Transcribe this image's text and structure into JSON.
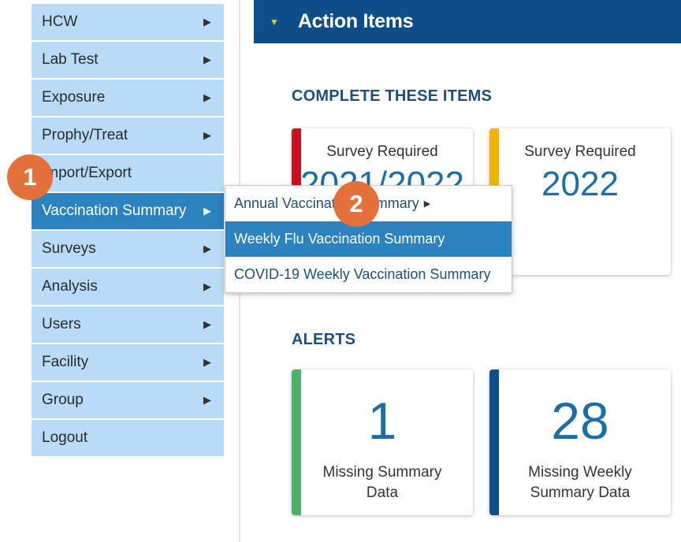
{
  "menu": {
    "items": [
      {
        "label": "HCW",
        "arrow": "▶"
      },
      {
        "label": "Lab Test",
        "arrow": "▶"
      },
      {
        "label": "Exposure",
        "arrow": "▶"
      },
      {
        "label": "Prophy/Treat",
        "arrow": "▶"
      },
      {
        "label": "Import/Export",
        "arrow": ""
      },
      {
        "label": "Vaccination Summary",
        "arrow": "▶"
      },
      {
        "label": "Surveys",
        "arrow": "▶"
      },
      {
        "label": "Analysis",
        "arrow": "▶"
      },
      {
        "label": "Users",
        "arrow": "▶"
      },
      {
        "label": "Facility",
        "arrow": "▶"
      },
      {
        "label": "Group",
        "arrow": "▶"
      },
      {
        "label": "Logout",
        "arrow": ""
      }
    ]
  },
  "submenu": {
    "items": [
      {
        "label": "Annual Vaccination Summary",
        "arrow": "▶"
      },
      {
        "label": "Weekly Flu Vaccination Summary"
      },
      {
        "label": "COVID-19 Weekly Vaccination Summary"
      }
    ]
  },
  "header": {
    "caret": "▼",
    "title": "Action Items"
  },
  "sections": {
    "complete": "COMPLETE THESE ITEMS",
    "alerts": "ALERTS"
  },
  "survey_cards": [
    {
      "label": "Survey Required",
      "value": "2021/2022",
      "color": "#c8101e"
    },
    {
      "label": "Survey Required",
      "value": "2022",
      "color": "#f0b400"
    }
  ],
  "alert_cards": [
    {
      "value": "1",
      "desc": "Missing Summary Data",
      "color": "#4caf6a"
    },
    {
      "value": "28",
      "desc": "Missing Weekly Summary Data",
      "color": "#0e4d8a"
    }
  ],
  "badges": {
    "one": "1",
    "two": "2"
  },
  "colors": {
    "menu_bg": "#b8dcf7",
    "menu_active": "#2b82be",
    "header": "#0e4d8a",
    "badge": "#e4703a"
  }
}
